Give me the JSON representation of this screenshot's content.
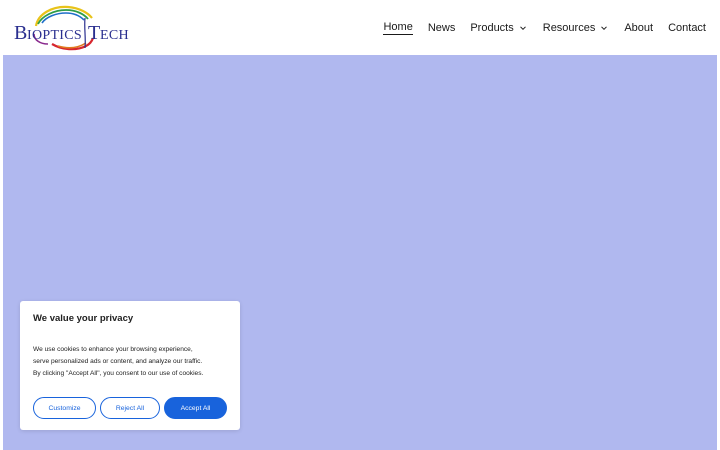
{
  "header": {
    "logo_text": "BIOPTICSTECH",
    "nav": [
      {
        "label": "Home",
        "active": true
      },
      {
        "label": "News"
      },
      {
        "label": "Products",
        "dropdown": true
      },
      {
        "label": "Resources",
        "dropdown": true
      },
      {
        "label": "About"
      },
      {
        "label": "Contact"
      }
    ]
  },
  "hero": {
    "color": "#b0b8ef"
  },
  "cookie": {
    "title": "We value your privacy",
    "text_line1": "We use cookies to enhance your browsing experience,",
    "text_line2": "serve personalized ads or content, and analyze our traffic.",
    "text_line3": "By clicking \"Accept All\", you consent to our use of cookies.",
    "customize_label": "Customize",
    "reject_label": "Reject All",
    "accept_label": "Accept All",
    "accent_color": "#1863dc"
  },
  "icons": {
    "dropdown": "chevron-down-icon"
  }
}
